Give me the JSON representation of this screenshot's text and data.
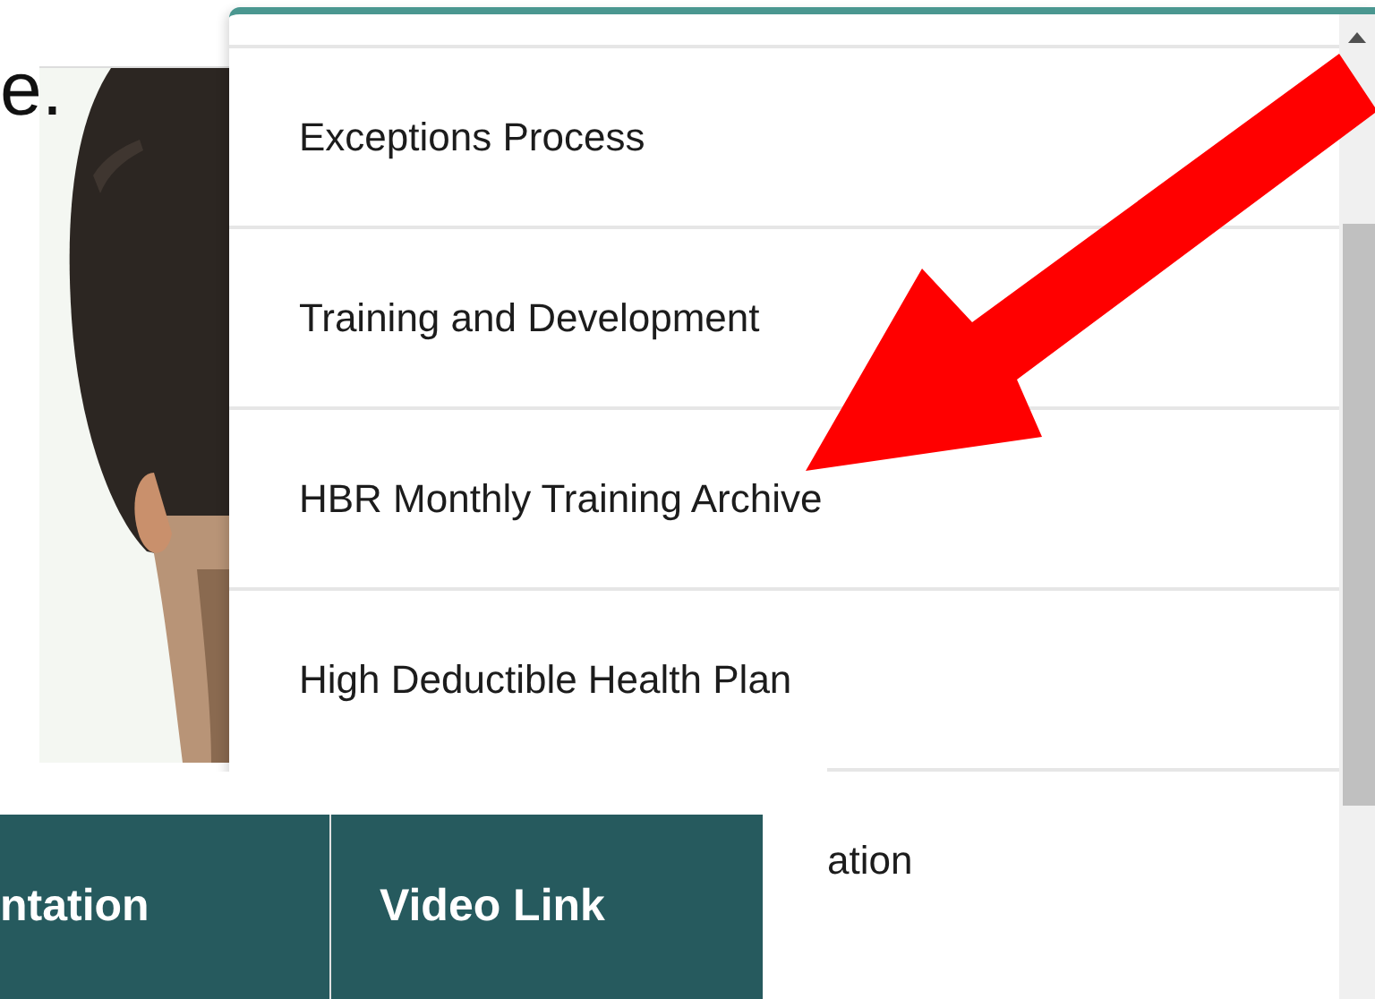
{
  "heading": "e.",
  "menu": {
    "items": [
      {
        "label": "Exceptions Process",
        "kind": "full"
      },
      {
        "label": "Training and Development",
        "kind": "full"
      },
      {
        "label": "HBR Monthly Training Archive",
        "kind": "full"
      },
      {
        "label": "High Deductible Health Plan",
        "kind": "full"
      },
      {
        "label": "ation",
        "kind": "partial"
      }
    ]
  },
  "table": {
    "columns": [
      "ntation",
      "Video Link"
    ]
  }
}
